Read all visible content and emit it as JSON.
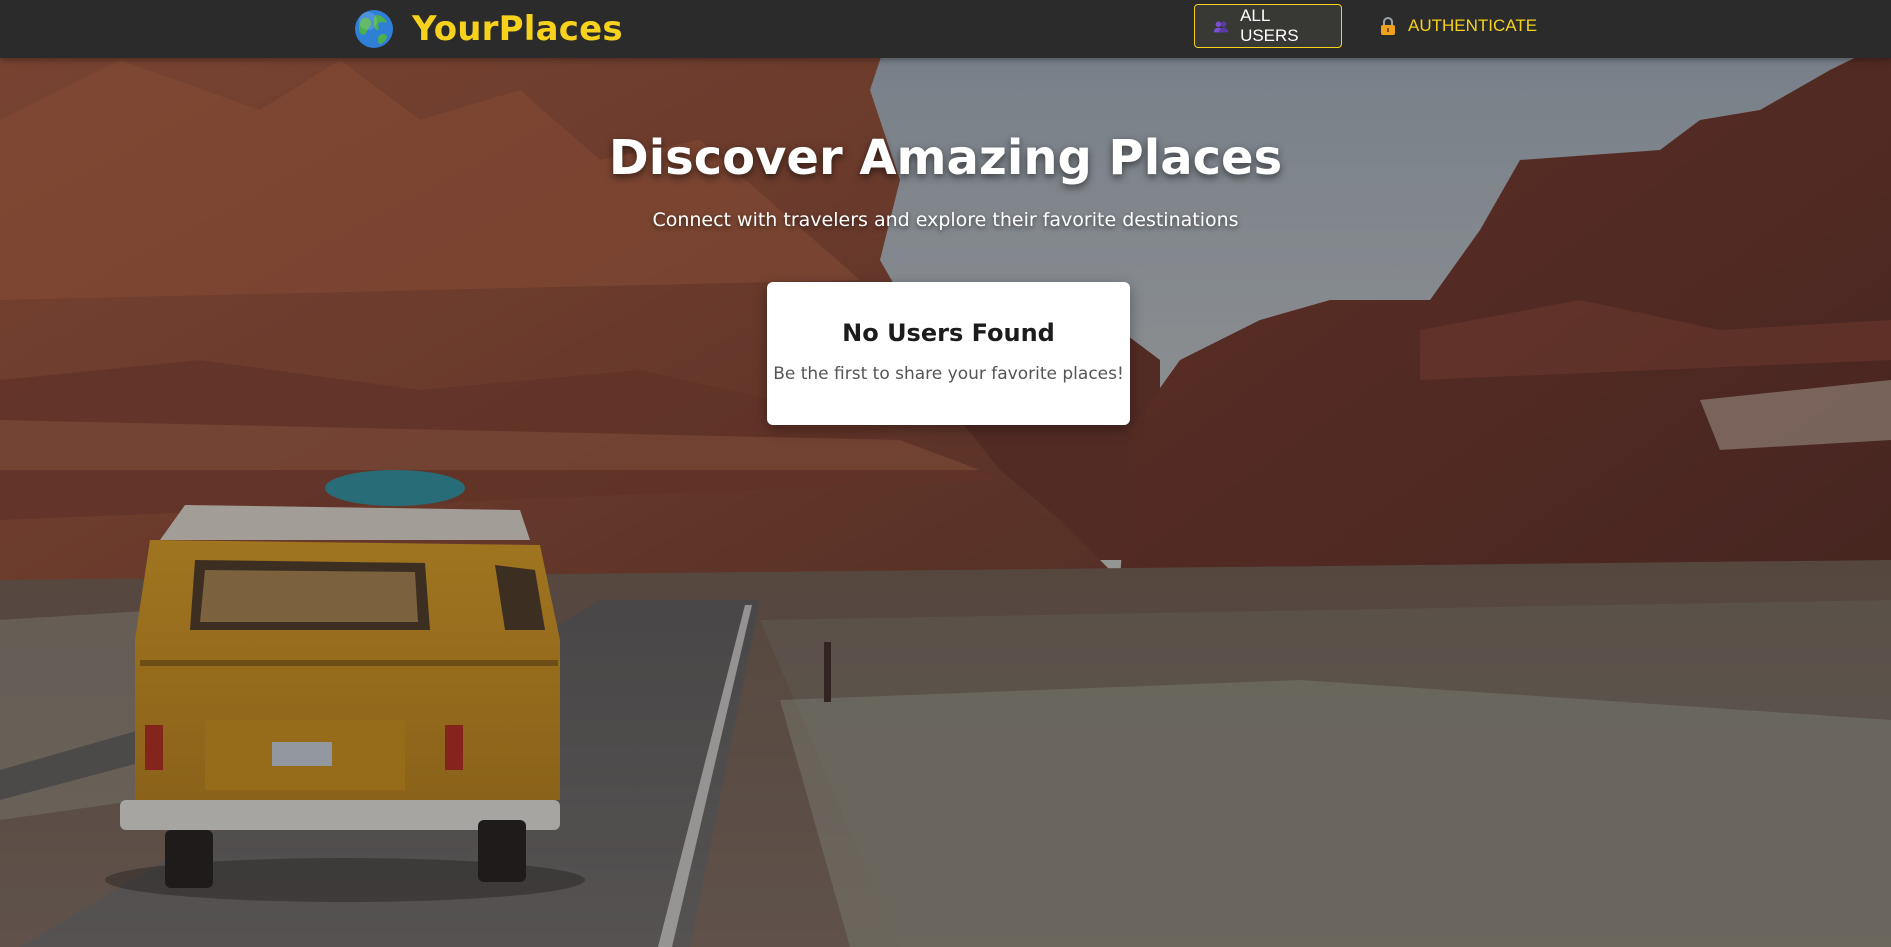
{
  "header": {
    "brand_name": "YourPlaces",
    "brand_icon": "globe-icon",
    "nav": {
      "all_users_label": "ALL USERS",
      "all_users_icon": "users-icon",
      "authenticate_label": "AUTHENTICATE",
      "authenticate_icon": "lock-icon"
    }
  },
  "hero": {
    "title": "Discover Amazing Places",
    "subtitle": "Connect with travelers and explore their favorite destinations"
  },
  "empty_state": {
    "title": "No Users Found",
    "message": "Be the first to share your favorite places!"
  },
  "colors": {
    "header_bg": "#2b2b2b",
    "accent": "#f7d21c",
    "card_bg": "#ffffff"
  }
}
